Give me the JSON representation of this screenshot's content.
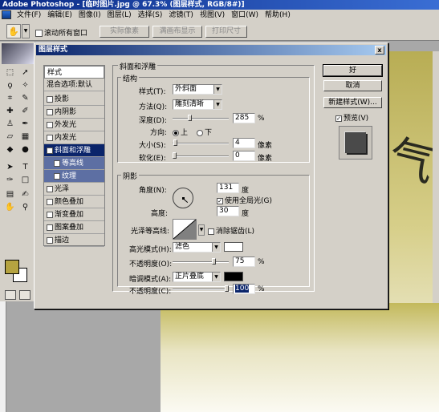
{
  "app_title": "Adobe Photoshop - [临时图片.jpg @ 67.3% (图层样式, RGB/8#)]",
  "menu": [
    "文件(F)",
    "编辑(E)",
    "图像(I)",
    "图层(L)",
    "选择(S)",
    "滤镜(T)",
    "视图(V)",
    "窗口(W)",
    "帮助(H)"
  ],
  "options_bar": {
    "scroll_all_label": "滚动所有窗口",
    "actual_pixels": "实际像素",
    "fit_screen": "满画布显示",
    "print_size": "打印尺寸"
  },
  "dialog": {
    "title": "图层样式",
    "close": "x",
    "styles_header": "样式",
    "blend_options": "混合选项:默认",
    "effects": [
      {
        "label": "投影",
        "checked": false
      },
      {
        "label": "内阴影",
        "checked": false
      },
      {
        "label": "外发光",
        "checked": false
      },
      {
        "label": "内发光",
        "checked": false
      },
      {
        "label": "斜面和浮雕",
        "checked": true,
        "selected": true
      },
      {
        "label": "等高线",
        "checked": false,
        "sub": true
      },
      {
        "label": "纹理",
        "checked": false,
        "sub": true
      },
      {
        "label": "光泽",
        "checked": false
      },
      {
        "label": "颜色叠加",
        "checked": false
      },
      {
        "label": "渐变叠加",
        "checked": false
      },
      {
        "label": "图案叠加",
        "checked": false
      },
      {
        "label": "描边",
        "checked": false
      }
    ],
    "bevel_title": "斜面和浮雕",
    "structure": {
      "title": "结构",
      "style_label": "样式(T):",
      "style_value": "外斜面",
      "method_label": "方法(Q):",
      "method_value": "雕刻清晰",
      "depth_label": "深度(D):",
      "depth_value": "285",
      "depth_unit": "%",
      "depth_level": 0.29,
      "direction_label": "方向:",
      "dir_up": "上",
      "dir_down": "下",
      "size_label": "大小(S):",
      "size_value": "4",
      "size_unit": "像素",
      "size_level": 0.02,
      "soften_label": "软化(E):",
      "soften_value": "0",
      "soften_unit": "像素",
      "soften_level": 0
    },
    "shading": {
      "title": "阴影",
      "angle_label": "角度(N):",
      "angle_value": "131",
      "angle_unit": "度",
      "global_light": "使用全局光(G)",
      "altitude_label": "高度:",
      "altitude_value": "30",
      "altitude_unit": "度",
      "gloss_label": "光泽等高线:",
      "antialias": "消除锯齿(L)",
      "highlight_label": "高光模式(H):",
      "highlight_value": "滤色",
      "highlight_color": "#ffffff",
      "hl_opacity_label": "不透明度(O):",
      "hl_opacity_value": "75",
      "hl_opacity_unit": "%",
      "hl_opacity_level": 0.75,
      "shadow_label": "暗调模式(A):",
      "shadow_value": "正片叠底",
      "shadow_color": "#000000",
      "sh_opacity_label": "不透明度(C):",
      "sh_opacity_value": "100",
      "sh_opacity_unit": "%",
      "sh_opacity_level": 1.0
    },
    "buttons": {
      "ok": "好",
      "cancel": "取消",
      "new_style": "新建样式(W)...",
      "preview": "预览(V)"
    }
  }
}
